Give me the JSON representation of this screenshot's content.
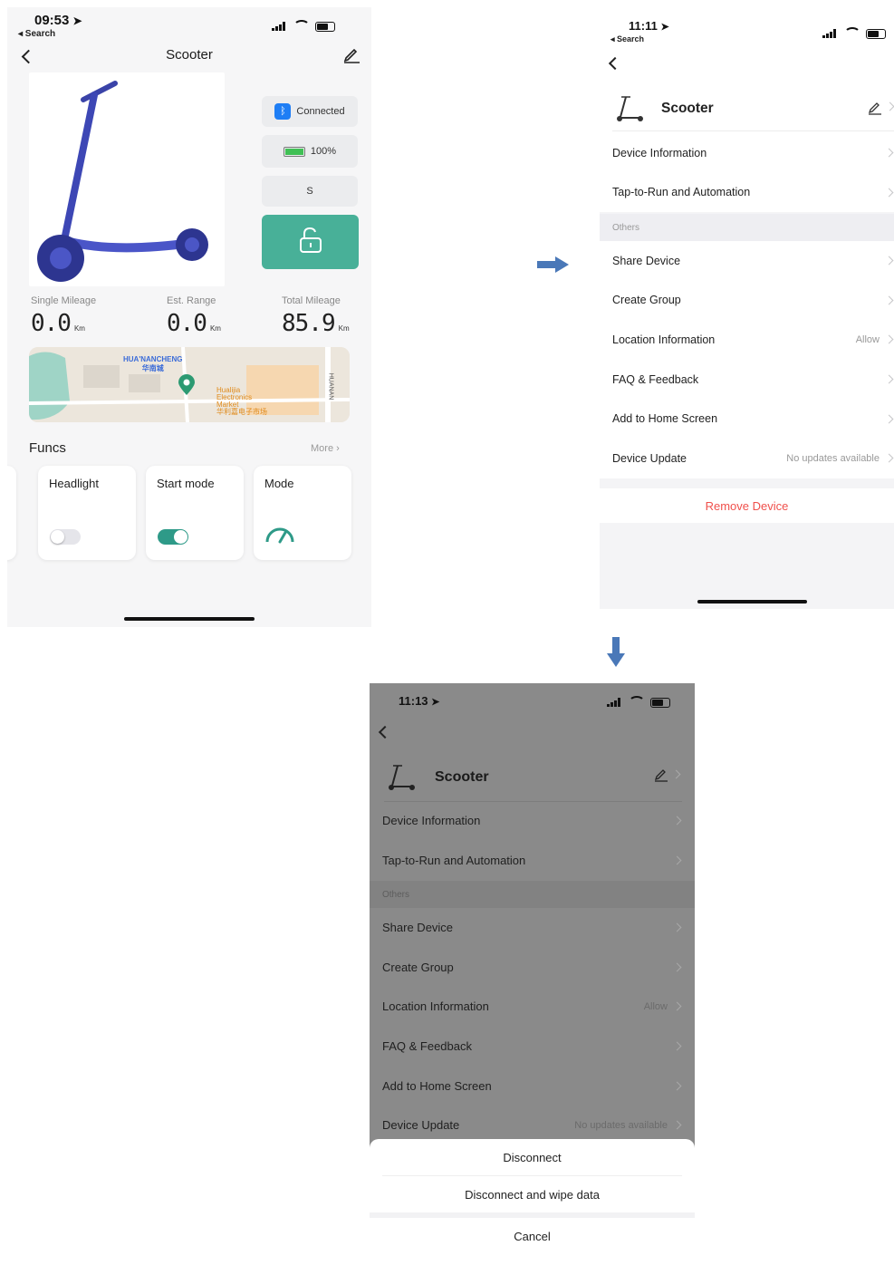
{
  "screen1": {
    "status": {
      "time": "09:53",
      "back_label": "◂ Search"
    },
    "nav": {
      "title": "Scooter"
    },
    "controls": {
      "connected_label": "Connected",
      "battery_label": "100%",
      "speed_label": "S"
    },
    "metrics": [
      {
        "label": "Single Mileage",
        "value": "0.0",
        "unit": "Km"
      },
      {
        "label": "Est. Range",
        "value": "0.0",
        "unit": "Km"
      },
      {
        "label": "Total Mileage",
        "value": "85.9",
        "unit": "Km"
      }
    ],
    "map": {
      "label1": "HUA'NANCHENG",
      "label1_cn": "华南城",
      "label2_l1": "Hualijia",
      "label2_l2": "Electronics",
      "label2_l3": "Market",
      "label2_cn": "华利嘉电子市场",
      "road": "HUANAN"
    },
    "funcs": {
      "title": "Funcs",
      "more": "More",
      "cards": [
        {
          "title": "Headlight"
        },
        {
          "title": "Start mode"
        },
        {
          "title": "Mode"
        }
      ]
    }
  },
  "screen2": {
    "status": {
      "time": "11:11",
      "back_label": "◂ Search"
    },
    "device_name": "Scooter",
    "rows_top": [
      {
        "label": "Device Information"
      },
      {
        "label": "Tap-to-Run and Automation"
      }
    ],
    "section": "Others",
    "rows_others": [
      {
        "label": "Share Device",
        "side": ""
      },
      {
        "label": "Create Group",
        "side": ""
      },
      {
        "label": "Location Information",
        "side": "Allow"
      },
      {
        "label": "FAQ & Feedback",
        "side": ""
      },
      {
        "label": "Add to Home Screen",
        "side": ""
      },
      {
        "label": "Device Update",
        "side": "No updates available"
      }
    ],
    "remove_label": "Remove Device"
  },
  "screen3": {
    "status": {
      "time": "11:13"
    },
    "device_name": "Scooter",
    "rows_top": [
      {
        "label": "Device Information"
      },
      {
        "label": "Tap-to-Run and Automation"
      }
    ],
    "section": "Others",
    "rows_others": [
      {
        "label": "Share Device",
        "side": ""
      },
      {
        "label": "Create Group",
        "side": ""
      },
      {
        "label": "Location Information",
        "side": "Allow"
      },
      {
        "label": "FAQ & Feedback",
        "side": ""
      },
      {
        "label": "Add to Home Screen",
        "side": ""
      },
      {
        "label": "Device Update",
        "side": "No updates available"
      }
    ],
    "sheet": {
      "disconnect": "Disconnect",
      "disconnect_wipe": "Disconnect and wipe data",
      "cancel": "Cancel"
    }
  },
  "colors": {
    "accent_teal": "#48b098",
    "bluetooth": "#1e7ef5",
    "danger": "#f0504c",
    "flow_arrow": "#4a78b8"
  },
  "icons": [
    "location-arrow-icon",
    "signal-icon",
    "wifi-icon",
    "battery-icon",
    "back-chevron-icon",
    "edit-pencil-icon",
    "bluetooth-icon",
    "unlock-icon",
    "speedometer-icon",
    "map-pin-icon",
    "chevron-right-icon",
    "scooter-icon"
  ]
}
